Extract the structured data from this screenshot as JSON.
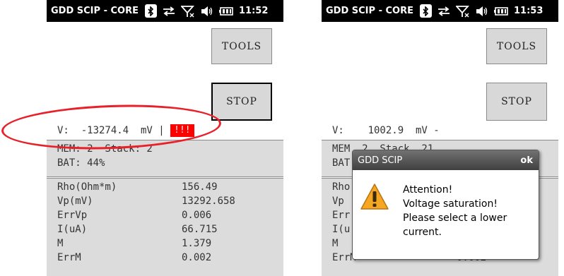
{
  "left": {
    "title": "GDD SCIP - CORE",
    "time": "11:52",
    "tools_label": "TOOLS",
    "stop_label": "STOP",
    "voltage_line": "V:  -13274.4  mV |",
    "voltage_alert": "!!!",
    "mem_line": "MEM: 2  Stack: 2",
    "bat_line": "BAT: 44%",
    "rows": [
      {
        "label": "Rho(Ohm*m)",
        "value": "156.49"
      },
      {
        "label": "Vp(mV)",
        "value": "13292.658"
      },
      {
        "label": "ErrVp",
        "value": "0.006"
      },
      {
        "label": "I(uA)",
        "value": "66.715"
      },
      {
        "label": "M",
        "value": "1.379"
      },
      {
        "label": "ErrM",
        "value": "0.002"
      }
    ]
  },
  "right": {
    "title": "GDD SCIP - CORE",
    "time": "11:53",
    "tools_label": "TOOLS",
    "stop_label": "STOP",
    "voltage_line": "V:    1002.9  mV -",
    "mem_line": "MEM  2  Stack  21",
    "bat_line": "BAT",
    "rows": [
      {
        "label": "Rho",
        "value": ""
      },
      {
        "label": "Vp",
        "value": ""
      },
      {
        "label": "Err",
        "value": ""
      },
      {
        "label": "I(u",
        "value": ""
      },
      {
        "label": "M",
        "value": ""
      },
      {
        "label": "ErrM",
        "value": "0.002"
      }
    ],
    "dialog": {
      "title": "GDD SCIP",
      "ok_label": "ok",
      "lines": [
        "Attention!",
        "Voltage saturation!",
        "Please select a lower",
        "current."
      ]
    }
  },
  "icons": [
    "bluetooth-icon",
    "sync-arrows-icon",
    "no-signal-icon",
    "volume-icon",
    "battery-icon",
    "warning-icon"
  ],
  "colors": {
    "titlebar": "#000000",
    "panel": "#dcdcdc",
    "alert": "#ff0000",
    "annotation": "#e8202a",
    "warning": "#f5a623"
  }
}
